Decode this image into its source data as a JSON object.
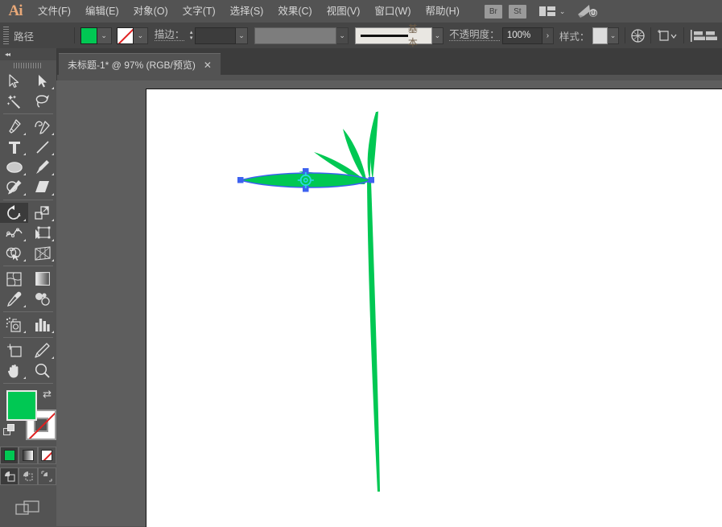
{
  "app": {
    "name": "Adobe Illustrator",
    "logo_text": "Ai"
  },
  "menubar": {
    "items": [
      {
        "label": "文件(F)",
        "name": "menu-file"
      },
      {
        "label": "编辑(E)",
        "name": "menu-edit"
      },
      {
        "label": "对象(O)",
        "name": "menu-object"
      },
      {
        "label": "文字(T)",
        "name": "menu-type"
      },
      {
        "label": "选择(S)",
        "name": "menu-select"
      },
      {
        "label": "效果(C)",
        "name": "menu-effect"
      },
      {
        "label": "视图(V)",
        "name": "menu-view"
      },
      {
        "label": "窗口(W)",
        "name": "menu-window"
      },
      {
        "label": "帮助(H)",
        "name": "menu-help"
      }
    ],
    "bridge_label": "Br",
    "stock_label": "St",
    "arrange_icon": "arrange-documents-icon",
    "arrange_caret": "⌄",
    "rocket_icon": "rocket-icon"
  },
  "controlbar": {
    "context_label": "路径",
    "fill_color": "#00c853",
    "stroke_color": "none",
    "stroke_label": "描边：",
    "stroke_weight": "",
    "stroke_weight_placeholder": "",
    "variable_width_profile": "",
    "brush_name": "基本",
    "opacity_label": "不透明度：",
    "opacity_value": "100%",
    "style_label": "样式：",
    "opacity_arrow": "›",
    "caret": "⌄",
    "spinner_up": "▴",
    "spinner_down": "▾",
    "transparency_icon": "transparency-icon",
    "transform_icon": "transform-icon",
    "align_left_icon": "align-left-icon",
    "align_center_icon": "align-center-icon"
  },
  "tabbar": {
    "tab_title": "未标题-1* @ 97% (RGB/预览)",
    "close_glyph": "✕"
  },
  "toolbar": {
    "collapse_glyph": "◂◂",
    "tools": [
      {
        "name": "selection-tool",
        "icon": "selection-arrow-icon",
        "selected": false,
        "has_flyout": false
      },
      {
        "name": "direct-selection-tool",
        "icon": "direct-selection-arrow-icon",
        "selected": false,
        "has_flyout": true
      },
      {
        "name": "magic-wand-tool",
        "icon": "magic-wand-icon",
        "selected": false,
        "has_flyout": false
      },
      {
        "name": "lasso-tool",
        "icon": "lasso-icon",
        "selected": false,
        "has_flyout": false
      },
      {
        "name": "pen-tool",
        "icon": "pen-icon",
        "selected": false,
        "has_flyout": true
      },
      {
        "name": "curvature-tool",
        "icon": "curvature-icon",
        "selected": false,
        "has_flyout": true
      },
      {
        "name": "type-tool",
        "icon": "type-t-icon",
        "selected": false,
        "has_flyout": true
      },
      {
        "name": "line-segment-tool",
        "icon": "line-segment-icon",
        "selected": false,
        "has_flyout": true
      },
      {
        "name": "ellipse-tool",
        "icon": "ellipse-icon",
        "selected": false,
        "has_flyout": true
      },
      {
        "name": "paintbrush-tool",
        "icon": "paintbrush-icon",
        "selected": false,
        "has_flyout": true
      },
      {
        "name": "shaper-tool",
        "icon": "shaper-pencil-icon",
        "selected": false,
        "has_flyout": true
      },
      {
        "name": "eraser-tool",
        "icon": "eraser-icon",
        "selected": false,
        "has_flyout": true
      },
      {
        "name": "rotate-tool",
        "icon": "rotate-icon",
        "selected": true,
        "has_flyout": true
      },
      {
        "name": "scale-tool",
        "icon": "scale-icon",
        "selected": false,
        "has_flyout": true
      },
      {
        "name": "width-tool",
        "icon": "width-warp-icon",
        "selected": false,
        "has_flyout": true
      },
      {
        "name": "free-transform-tool",
        "icon": "free-transform-icon",
        "selected": false,
        "has_flyout": true
      },
      {
        "name": "shape-builder-tool",
        "icon": "shape-builder-icon",
        "selected": false,
        "has_flyout": true
      },
      {
        "name": "perspective-grid-tool",
        "icon": "perspective-grid-icon",
        "selected": false,
        "has_flyout": true
      },
      {
        "name": "mesh-tool",
        "icon": "mesh-icon",
        "selected": false,
        "has_flyout": false
      },
      {
        "name": "gradient-tool",
        "icon": "gradient-icon",
        "selected": false,
        "has_flyout": false
      },
      {
        "name": "eyedropper-tool",
        "icon": "eyedropper-icon",
        "selected": false,
        "has_flyout": true
      },
      {
        "name": "blend-tool",
        "icon": "blend-icon",
        "selected": false,
        "has_flyout": false
      },
      {
        "name": "symbol-sprayer-tool",
        "icon": "symbol-sprayer-icon",
        "selected": false,
        "has_flyout": true
      },
      {
        "name": "column-graph-tool",
        "icon": "column-graph-icon",
        "selected": false,
        "has_flyout": true
      },
      {
        "name": "artboard-tool",
        "icon": "artboard-icon",
        "selected": false,
        "has_flyout": false
      },
      {
        "name": "slice-tool",
        "icon": "slice-knife-icon",
        "selected": false,
        "has_flyout": true
      },
      {
        "name": "hand-tool",
        "icon": "hand-icon",
        "selected": false,
        "has_flyout": true
      },
      {
        "name": "zoom-tool",
        "icon": "magnifier-icon",
        "selected": false,
        "has_flyout": false
      }
    ],
    "color": {
      "fill_color": "#00c853",
      "stroke_color": "none",
      "swap_glyph": "⇄",
      "default_colors_icon": "default-fill-stroke-icon",
      "modes": [
        {
          "name": "color-mode-solid",
          "icon": "solid-color-icon",
          "active": true
        },
        {
          "name": "color-mode-gradient",
          "icon": "gradient-swatch-icon",
          "active": false
        },
        {
          "name": "color-mode-none",
          "icon": "none-swatch-icon",
          "active": false
        }
      ],
      "draw_modes": [
        {
          "name": "draw-normal",
          "icon": "draw-normal-icon",
          "active": true
        },
        {
          "name": "draw-behind",
          "icon": "draw-behind-icon",
          "active": false
        },
        {
          "name": "draw-inside",
          "icon": "draw-inside-icon",
          "active": false
        }
      ],
      "screen_mode_icon": "change-screen-mode-icon"
    }
  },
  "canvas": {
    "zoom": "97%",
    "artwork_name": "bamboo-leaves-drawing",
    "artwork_fill": "#00c853",
    "selection_color": "#3d62f0",
    "anchor_color": "#3d62f0",
    "rotate_origin_color": "#2ad6e0",
    "selected_object": "horizontal-leaf-path"
  }
}
